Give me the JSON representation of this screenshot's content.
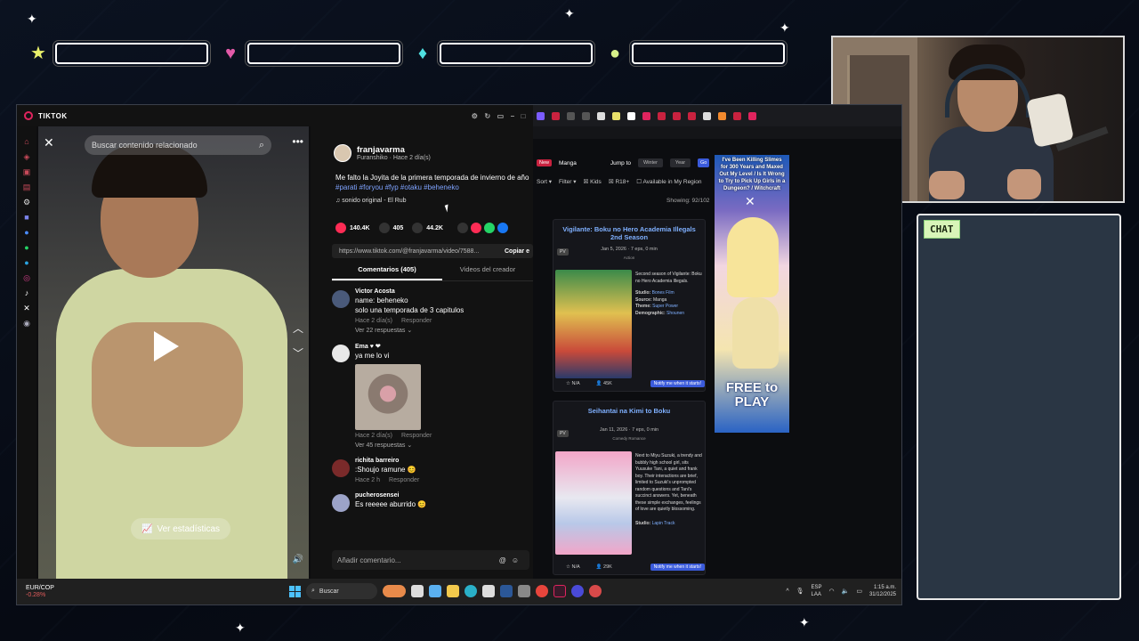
{
  "overlay": {
    "stats": [
      {
        "icon": "star-icon",
        "symbol": "★",
        "color": "#e8f06a"
      },
      {
        "icon": "heart-icon",
        "symbol": "♥",
        "color": "#e35aa8"
      },
      {
        "icon": "diamond-icon",
        "symbol": "♦",
        "color": "#4fe0e0"
      },
      {
        "icon": "coin-icon",
        "symbol": "●",
        "color": "#d7f08a"
      }
    ],
    "chat_label": "CHAT"
  },
  "app": {
    "title": "TIKTOK",
    "search_placeholder": "Buscar contenido relacionado",
    "stats_button": "Ver estadísticas"
  },
  "post": {
    "author": "franjavarma",
    "subtitle": "Furanshiko · Hace 2 día(s)",
    "caption": "Me falto la Joyita de la primera temporada de invierno de año",
    "tags": "#parati #foryou #fyp #otaku #beheneko",
    "sound": "sonido original - El Rub",
    "likes": "140.4K",
    "comments_count": "405",
    "saves": "44.2K",
    "url": "https://www.tiktok.com/@franjavarma/video/7588...",
    "copy_label": "Copiar e",
    "tab_comments": "Comentarios (405)",
    "tab_creator": "Videos del creador",
    "composer_placeholder": "Añadir comentario..."
  },
  "comments": [
    {
      "user": "Victor Acosta",
      "text": "name: beheneko\nsolo una temporada de 3 capitulos",
      "time": "Hace 2 día(s)",
      "reply": "Responder",
      "more": "Ver 22 respuestas ⌄",
      "color": "#4a5a7a"
    },
    {
      "user": "Ema ♥ ❤",
      "text": "ya me lo vi",
      "time": "Hace 2 día(s)",
      "reply": "Responder",
      "more": "Ver 45 respuestas ⌄",
      "color": "#e8e8e8"
    },
    {
      "user": "richita barreiro",
      "text": ":Shoujo ramune 😊",
      "time": "Hace 2 h",
      "reply": "Responder",
      "more": "",
      "color": "#7a2a2a"
    },
    {
      "user": "pucherosensei",
      "text": "Es reeeee aburrido 😊",
      "time": "",
      "reply": "",
      "more": "",
      "color": "#9ca3c8"
    }
  ],
  "schedule": {
    "new_label": "New",
    "manga_label": "Manga",
    "jump_label": "Jump to",
    "season": "Winter",
    "year": "Year",
    "go": "Go",
    "sort": "Sort ▾",
    "filter": "Filter ▾",
    "kids": "Kids",
    "r18": "R18+",
    "region": "Available in My Region",
    "showing": "Showing: 92/102"
  },
  "anime": [
    {
      "title": "Vigilante: Boku no Hero Academia Illegals 2nd Season",
      "date": "Jan 5, 2026",
      "eps": "7 eps, 0 min",
      "genres": "Action",
      "desc": "Second season of Vigilante: Boku no Hero Academia Illegals.",
      "studio": "Bones Film",
      "source": "Manga",
      "theme": "Super Power",
      "demographic": "Shounen",
      "score": "N/A",
      "members": "45K",
      "notify": "Notify me when it starts!"
    },
    {
      "title": "Seihantai na Kimi to Boku",
      "date": "Jan 11, 2026",
      "eps": "7 eps, 0 min",
      "genres": "Comedy   Romance",
      "desc": "Next to Miyu Suzuki, a trendy and bubbly high school girl, sits Yuusuke Tani, a quiet and frank boy. Their interactions are brief, limited to Suzuki's unprompted random questions and Tani's succinct answers. Yet, beneath these simple exchanges, feelings of love are quietly blossoming.",
      "studio": "Lapin Track",
      "score": "N/A",
      "members": "29K",
      "notify": "Notify me when it starts!"
    }
  ],
  "ad": {
    "top_text": "I've Been Killing Slimes for 300 Years and Maxed Out My Level / Is It Wrong to Try to Pick Up Girls in a Dungeon? / Witchcraft",
    "bottom_text": "FREE to PLAY"
  },
  "taskbar": {
    "fx_pair": "EUR/COP",
    "fx_change": "-0.28%",
    "search": "Buscar",
    "lang1": "ESP",
    "lang2": "LAA",
    "time": "1:15 a.m.",
    "date": "31/12/2025"
  }
}
